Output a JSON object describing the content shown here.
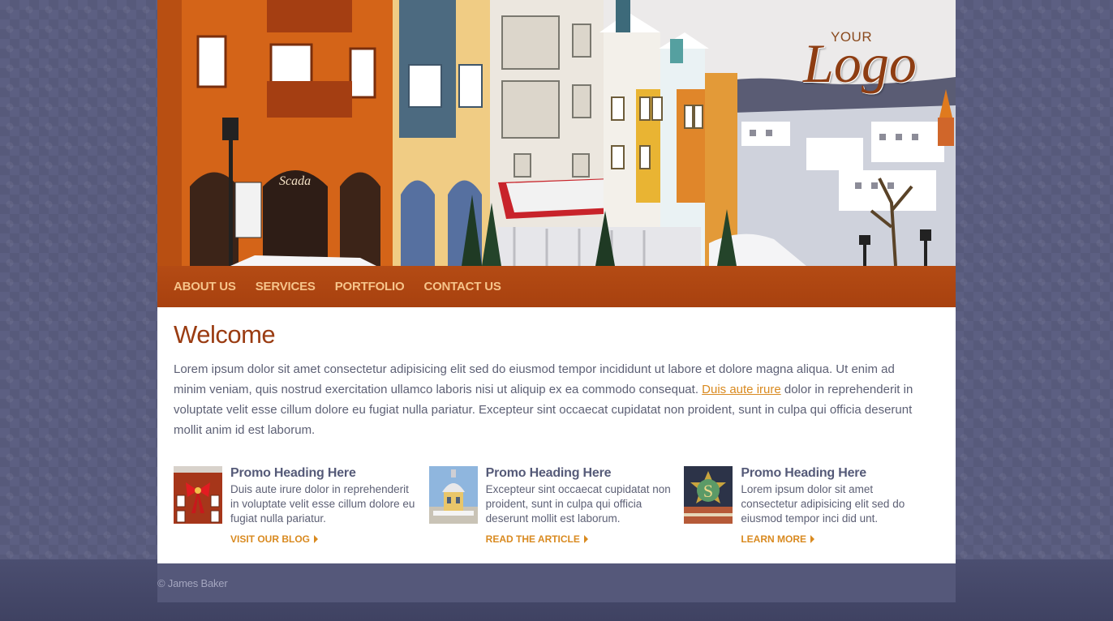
{
  "header": {
    "image_alt": "Colorful village buildings in winter",
    "logo": {
      "small": "YOUR",
      "main": "Logo"
    }
  },
  "nav": {
    "items": [
      {
        "label": "ABOUT US"
      },
      {
        "label": "SERVICES"
      },
      {
        "label": "PORTFOLIO"
      },
      {
        "label": "CONTACT US"
      }
    ]
  },
  "main": {
    "title": "Welcome",
    "intro_before": "Lorem ipsum dolor sit amet consectetur adipisicing elit sed do eiusmod tempor incididunt ut labore et dolore magna aliqua. Ut enim ad minim veniam, quis nostrud exercitation ullamco laboris nisi ut aliquip ex ea commodo consequat. ",
    "intro_link": "Duis aute irure",
    "intro_after": " dolor in reprehenderit in voluptate velit esse cillum dolore eu fugiat nulla pariatur. Excepteur sint occaecat cupidatat non proident, sunt in culpa qui officia deserunt mollit anim id est laborum."
  },
  "promos": [
    {
      "heading": "Promo Heading Here",
      "text": "Duis aute irure dolor in reprehenderit in voluptate velit esse cillum dolore eu fugiat nulla pariatur.",
      "link": "VISIT OUR BLOG"
    },
    {
      "heading": "Promo Heading Here",
      "text": "Excepteur sint occaecat cupidatat non proident, sunt in culpa qui officia deserunt mollit est laborum.",
      "link": "READ THE ARTICLE"
    },
    {
      "heading": "Promo Heading Here",
      "text": "Lorem ipsum dolor sit amet consectetur adipisicing elit sed do eiusmod tempor inci did unt.",
      "link": "LEARN MORE"
    }
  ],
  "footer": {
    "copyright": "© James Baker"
  }
}
